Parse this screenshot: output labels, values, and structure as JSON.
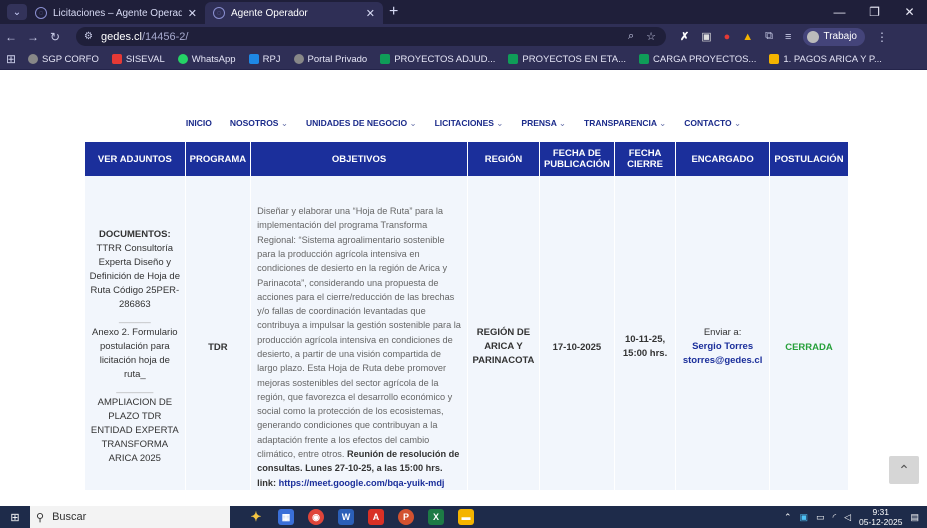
{
  "browser": {
    "tabs": [
      {
        "title": "Licitaciones – Agente Operador",
        "active": false
      },
      {
        "title": "Agente Operador",
        "active": true
      }
    ],
    "url_host": "gedes.cl",
    "url_path": "/14456-2/",
    "profile_label": "Trabajo",
    "bookmarks": [
      "SGP CORFO",
      "SISEVAL",
      "WhatsApp",
      "RPJ",
      "Portal Privado",
      "PROYECTOS ADJUD...",
      "PROYECTOS EN ETA...",
      "CARGA PROYECTOS...",
      "1. PAGOS ARICA Y P..."
    ]
  },
  "site_nav": [
    {
      "label": "INICIO",
      "dropdown": false
    },
    {
      "label": "NOSOTROS",
      "dropdown": true
    },
    {
      "label": "UNIDADES DE NEGOCIO",
      "dropdown": true
    },
    {
      "label": "LICITACIONES",
      "dropdown": true
    },
    {
      "label": "PRENSA",
      "dropdown": true
    },
    {
      "label": "TRANSPARENCIA",
      "dropdown": true
    },
    {
      "label": "CONTACTO",
      "dropdown": true
    }
  ],
  "table": {
    "headers": [
      "VER ADJUNTOS",
      "PROGRAMA",
      "OBJETIVOS",
      "REGIÓN",
      "FECHA DE PUBLICACIÓN",
      "FECHA CIERRE",
      "ENCARGADO",
      "POSTULACIÓN"
    ],
    "row": {
      "adjuntos": {
        "title": "DOCUMENTOS:",
        "link1": "TTRR Consultoría Experta Diseño y Definición de Hoja de Ruta Código 25PER-286863",
        "sep1": "______",
        "link2": "Anexo 2. Formulario postulación para licitación hoja de ruta_",
        "sep2": "_______",
        "link3": "AMPLIACION DE PLAZO TDR ENTIDAD EXPERTA TRANSFORMA ARICA 2025"
      },
      "programa": "TDR",
      "objetivos": "Diseñar y elaborar una “Hoja de Ruta” para la implementación del programa Transforma Regional: “Sistema agroalimentario sostenible para la producción agrícola intensiva en condiciones de desierto en la región de Arica y Parinacota”, considerando una propuesta de acciones para el cierre/reducción de las brechas y/o fallas de coordinación levantadas que contribuya a impulsar la gestión sostenible para la producción agrícola intensiva en condiciones de desierto, a partir de una visión compartida de largo plazo. Esta Hoja de Ruta debe promover mejoras sostenibles del sector agrícola de la región, que favorezca el desarrollo económico y social como la protección de los ecosistemas, generando condiciones que contribuyan a la adaptación frente a los efectos del cambio climático, entre otros.",
      "objetivos_bold": "Reunión de resolución de consultas. Lunes 27-10-25, a las 15:00 hrs. link:",
      "objetivos_link": "https://meet.google.com/bqa-yuik-mdj",
      "region": "REGIÓN DE ARICA Y PARINACOTA",
      "fecha_publicacion": "17-10-2025",
      "fecha_cierre": "10-11-25, 15:00 hrs.",
      "encargado_prefix": "Enviar a:",
      "encargado_name": "Sergio Torres",
      "encargado_email": "storres@gedes.cl",
      "postulacion": "CERRADA"
    }
  },
  "taskbar": {
    "search_placeholder": "Buscar",
    "time": "9:31",
    "date": "05-12-2025"
  }
}
